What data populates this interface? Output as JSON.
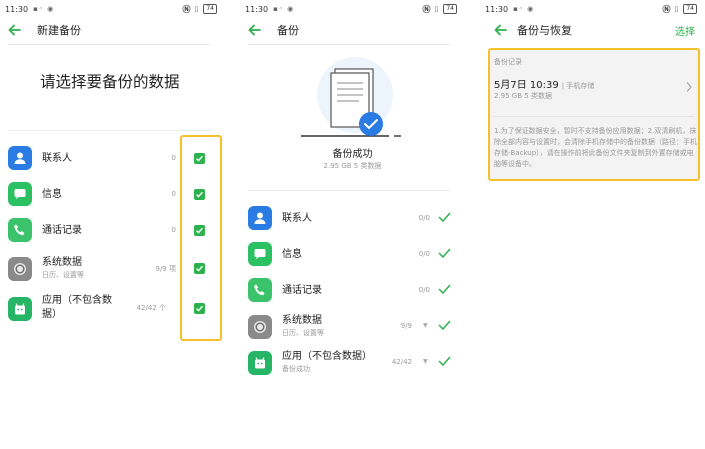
{
  "status": {
    "time": "11:30",
    "battery": "74"
  },
  "screen1": {
    "nav_title": "新建备份",
    "heading": "请选择要备份的数据",
    "items": [
      {
        "label": "联系人",
        "sub": "",
        "count": "0",
        "icon": "contact-icon",
        "checked": true
      },
      {
        "label": "信息",
        "sub": "",
        "count": "0",
        "icon": "message-icon",
        "checked": true
      },
      {
        "label": "通话记录",
        "sub": "",
        "count": "0",
        "icon": "phone-icon",
        "checked": true
      },
      {
        "label": "系统数据",
        "sub": "日历、设置等",
        "count": "9/9 项",
        "icon": "system-data-icon",
        "checked": true
      },
      {
        "label": "应用（不包含数",
        "label2": "据）",
        "sub": "",
        "count": "42/42 个",
        "icon": "app-icon",
        "checked": true
      }
    ]
  },
  "screen2": {
    "nav_title": "备份",
    "success": "备份成功",
    "success_sub": "2.95 GB  5 类数据",
    "items": [
      {
        "label": "联系人",
        "sub": "",
        "count": "0/0",
        "icon": "contact-icon"
      },
      {
        "label": "信息",
        "sub": "",
        "count": "0/0",
        "icon": "message-icon"
      },
      {
        "label": "通话记录",
        "sub": "",
        "count": "0/0",
        "icon": "phone-icon"
      },
      {
        "label": "系统数据",
        "sub": "日历、设置等",
        "count": "9/9",
        "icon": "system-data-icon"
      },
      {
        "label": "应用（不包含数据）",
        "sub": "备份成功",
        "count": "42/42",
        "icon": "app-icon"
      }
    ]
  },
  "screen3": {
    "nav_title": "备份与恢复",
    "action": "选择",
    "record_header": "备份记录",
    "record_date": "5月7日 10:39",
    "record_location": "| 手机存储",
    "record_size": "2.95 GB  5 类数据",
    "note": "1.为了保证数据安全，暂时不支持备份应用数据；2.双清刷机，抹除全部内容与设置时，会清除手机存储中的备份数据（路径：手机存储-Backup），请在操作前将此备份文件夹复制到外置存储或电脑等设备中。"
  },
  "colors": {
    "accent": "#2bb24c",
    "highlight": "#f5c02a",
    "contact": "#2a7be4",
    "message": "#2bc062"
  }
}
